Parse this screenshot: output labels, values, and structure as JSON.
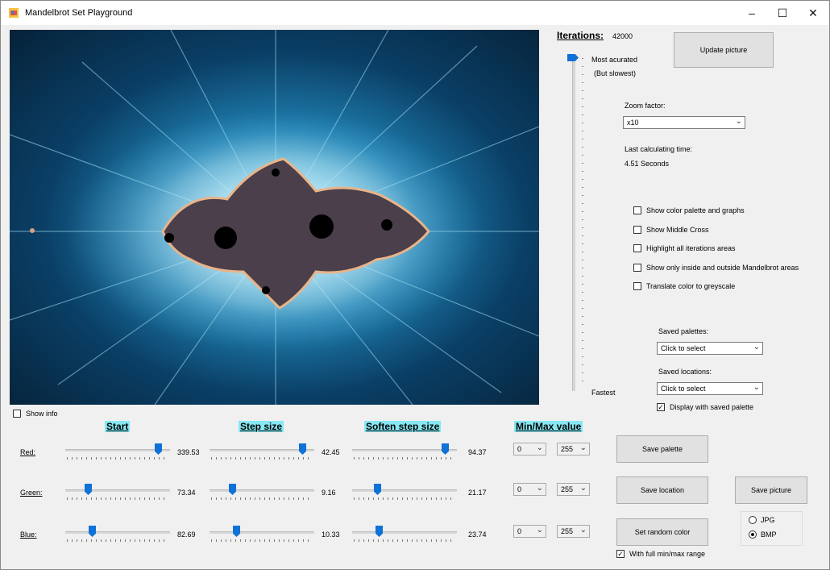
{
  "window": {
    "title": "Mandelbrot Set Playground",
    "minimize_icon": "minimize-icon",
    "maximize_icon": "maximize-icon",
    "close_icon": "close-icon"
  },
  "iterations": {
    "label": "Iterations:",
    "value": "42000",
    "top_label": "Most acurated",
    "top_sub": "(But slowest)",
    "bottom_label": "Fastest"
  },
  "update_button": "Update picture",
  "zoom": {
    "label": "Zoom factor:",
    "value": "x10"
  },
  "timing": {
    "label": "Last calculating time:",
    "value": "4.51 Seconds"
  },
  "options": [
    {
      "label": "Show color palette and graphs",
      "checked": false
    },
    {
      "label": "Show Middle Cross",
      "checked": false
    },
    {
      "label": "Highlight all iterations areas",
      "checked": false
    },
    {
      "label": "Show only inside and outside Mandelbrot areas",
      "checked": false
    },
    {
      "label": "Translate color to greyscale",
      "checked": false
    }
  ],
  "saved_palettes": {
    "label": "Saved palettes:",
    "value": "Click to select"
  },
  "saved_locations": {
    "label": "Saved locations:",
    "value": "Click to select"
  },
  "display_saved_palette": {
    "label": "Display with saved palette",
    "checked": true
  },
  "show_info": {
    "label": "Show info",
    "checked": false
  },
  "headers": {
    "start": "Start",
    "step": "Step size",
    "soften": "Soften step size",
    "minmax": "Min/Max value"
  },
  "channels": [
    {
      "label": "Red:",
      "start": "339.53",
      "step": "42.45",
      "soften": "94.37",
      "min": "0",
      "max": "255",
      "start_level": 0.92,
      "step_level": 0.92,
      "soften_level": 0.92
    },
    {
      "label": "Green:",
      "start": "73.34",
      "step": "9.16",
      "soften": "21.17",
      "min": "0",
      "max": "255",
      "start_level": 0.2,
      "step_level": 0.2,
      "soften_level": 0.22
    },
    {
      "label": "Blue:",
      "start": "82.69",
      "step": "10.33",
      "soften": "23.74",
      "min": "0",
      "max": "255",
      "start_level": 0.24,
      "step_level": 0.24,
      "soften_level": 0.24
    }
  ],
  "buttons": {
    "save_palette": "Save  palette",
    "save_location": "Save location",
    "save_picture": "Save picture",
    "random_color": "Set random color"
  },
  "full_range": {
    "label": "With full min/max range",
    "checked": true
  },
  "image_format": {
    "jpg": "JPG",
    "bmp": "BMP",
    "selected": "BMP"
  },
  "colors": {
    "accent": "#0f72d6",
    "header_highlight": "#86e8f3"
  }
}
